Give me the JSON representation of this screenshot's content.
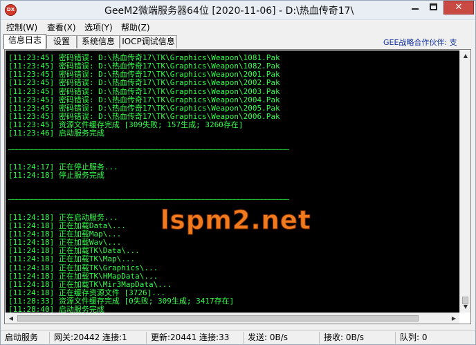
{
  "window": {
    "title": "GeeM2微端服务器64位 [2020-11-06] - D:\\热血传奇17\\",
    "icon_label": "DX"
  },
  "menu": {
    "items": [
      "控制(W)",
      "查看(X)",
      "选项(Y)",
      "帮助(Z)"
    ]
  },
  "tabs": {
    "items": [
      "信息日志",
      "设置",
      "系统信息",
      "IOCP调试信息"
    ],
    "active": "信息日志"
  },
  "partner_link": "GEE战略合作伙伴: 支",
  "log": {
    "lines": [
      "[11:23:45] 密码错误: D:\\热血传奇17\\TK\\Graphics\\Weapon\\1081.Pak",
      "[11:23:45] 密码错误: D:\\热血传奇17\\TK\\Graphics\\Weapon\\1082.Pak",
      "[11:23:45] 密码错误: D:\\热血传奇17\\TK\\Graphics\\Weapon\\2001.Pak",
      "[11:23:45] 密码错误: D:\\热血传奇17\\TK\\Graphics\\Weapon\\2002.Pak",
      "[11:23:45] 密码错误: D:\\热血传奇17\\TK\\Graphics\\Weapon\\2003.Pak",
      "[11:23:45] 密码错误: D:\\热血传奇17\\TK\\Graphics\\Weapon\\2004.Pak",
      "[11:23:45] 密码错误: D:\\热血传奇17\\TK\\Graphics\\Weapon\\2005.Pak",
      "[11:23:45] 密码错误: D:\\热血传奇17\\TK\\Graphics\\Weapon\\2006.Pak",
      "[11:23:45] 资源文件缓存完成 [309失败; 157生成; 3260存在]",
      "[11:23:46] 启动服务完成",
      "",
      "————————————————————————————————————————————————————————————————————————",
      "",
      "[11:24:17] 正在停止服务...",
      "[11:24:18] 停止服务完成",
      "",
      "",
      "————————————————————————————————————————————————————————————————————————",
      "",
      "[11:24:18] 正在启动服务...",
      "[11:24:18] 正在加载Data\\...",
      "[11:24:18] 正在加载Map\\...",
      "[11:24:18] 正在加载Wav\\...",
      "[11:24:18] 正在加载TK\\Data\\...",
      "[11:24:18] 正在加载TK\\Map\\...",
      "[11:24:18] 正在加载TK\\Graphics\\...",
      "[11:24:18] 正在加载TK\\HMapData\\...",
      "[11:24:18] 正在加载TK\\Mir3MapData\\...",
      "[11:24:18] 正在缓存资源文件 [3726]...",
      "[11:28:33] 资源文件缓存完成 [0失败; 309生成; 3417存在]",
      "[11:28:40] 启动服务完成"
    ]
  },
  "watermark": "lspm2.net",
  "statusbar": {
    "start_service": "启动服务",
    "gateway": "网关:20442  连接:1",
    "update": "更新:20441  连接:33",
    "send": "发送: 0B/s",
    "receive": "接收: 0B/s",
    "queue": "队列: 0"
  }
}
